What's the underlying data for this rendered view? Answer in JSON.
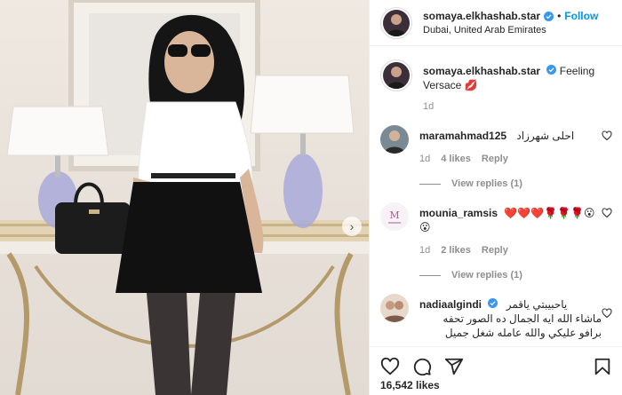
{
  "post": {
    "header": {
      "username": "somaya.elkhashab.star",
      "separator": "•",
      "follow_label": "Follow",
      "location": "Dubai, United Arab Emirates",
      "avatar_icon": "profile-avatar"
    },
    "caption": {
      "username": "somaya.elkhashab.star",
      "text": "Feeling Versace 💋",
      "time": "1d"
    },
    "comments": [
      {
        "username": "maramahmad125",
        "text": "احلى شهرزاد",
        "time": "1d",
        "likes": "4 likes",
        "reply_label": "Reply",
        "view_replies": "View replies (1)"
      },
      {
        "username": "mounia_ramsis",
        "text": "❤️❤️❤️🌹🌹🌹😮😮",
        "time": "1d",
        "likes": "2 likes",
        "reply_label": "Reply",
        "view_replies": "View replies (1)"
      },
      {
        "username": "nadiaalgindi",
        "text": "ياحبيبتي ياقمر",
        "line2": "ماشاء الله ايه الجمال ده الصور تحفه",
        "line3": "برافو عليكي والله عامله شغل جميل"
      }
    ],
    "likes_total": "16,542 likes",
    "colors": {
      "accent": "#0095f6",
      "text": "#262626",
      "muted": "#8e8e8e",
      "border": "#efefef"
    },
    "icons": [
      "heart-icon",
      "comment-icon",
      "share-icon",
      "bookmark-icon",
      "verified-badge-icon",
      "next-arrow-icon"
    ]
  }
}
